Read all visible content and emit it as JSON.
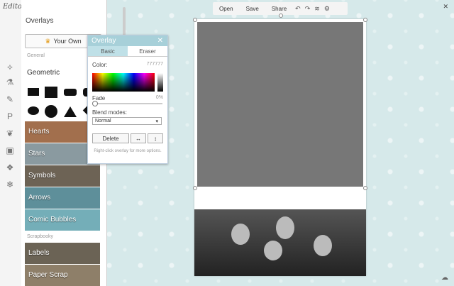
{
  "app": {
    "name": "Editor"
  },
  "topbar": {
    "open": "Open",
    "save": "Save",
    "share": "Share",
    "close": "✕"
  },
  "panel": {
    "title": "Overlays",
    "your_own": "Your Own",
    "section_general": "General",
    "geometric": "Geometric",
    "items": [
      "Hearts",
      "Stars",
      "Symbols",
      "Arrows",
      "Comic Bubbles"
    ],
    "section_scrapbooky": "Scrapbooky",
    "items2": [
      "Labels",
      "Paper Scrap"
    ]
  },
  "dialog": {
    "title": "Overlay",
    "tabs": [
      "Basic",
      "Eraser"
    ],
    "color_label": "Color:",
    "color_value": "777777",
    "fade_label": "Fade",
    "fade_value": "0%",
    "blend_label": "Blend modes:",
    "blend_value": "Normal",
    "delete": "Delete",
    "hint": "Right-click overlay for more options."
  },
  "colors": {
    "overlay": "#777777",
    "accent": "#a7d0d9"
  }
}
